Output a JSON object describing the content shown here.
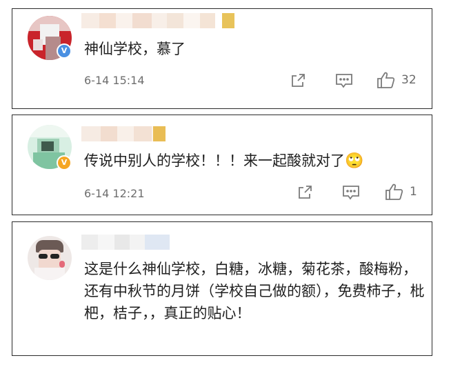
{
  "comments": [
    {
      "text": "神仙学校，慕了",
      "time": "6-14 15:14",
      "likes": "32",
      "badge_color": "#4a90e2",
      "badge_glyph": "V"
    },
    {
      "text": "传说中别人的学校！！！来一起酸就对了",
      "emoji": "🙄",
      "time": "6-14 12:21",
      "likes": "1",
      "badge_color": "#f5a623",
      "badge_glyph": "V"
    },
    {
      "text": "这是什么神仙学校，白糖，冰糖，菊花茶，酸梅粉，还有中秋节的月饼（学校自己做的额），免费柿子，枇杷，桔子，，真正的贴心！"
    }
  ],
  "icons": {
    "share": "share-icon",
    "comment": "comment-icon",
    "like": "thumbs-up-icon"
  }
}
